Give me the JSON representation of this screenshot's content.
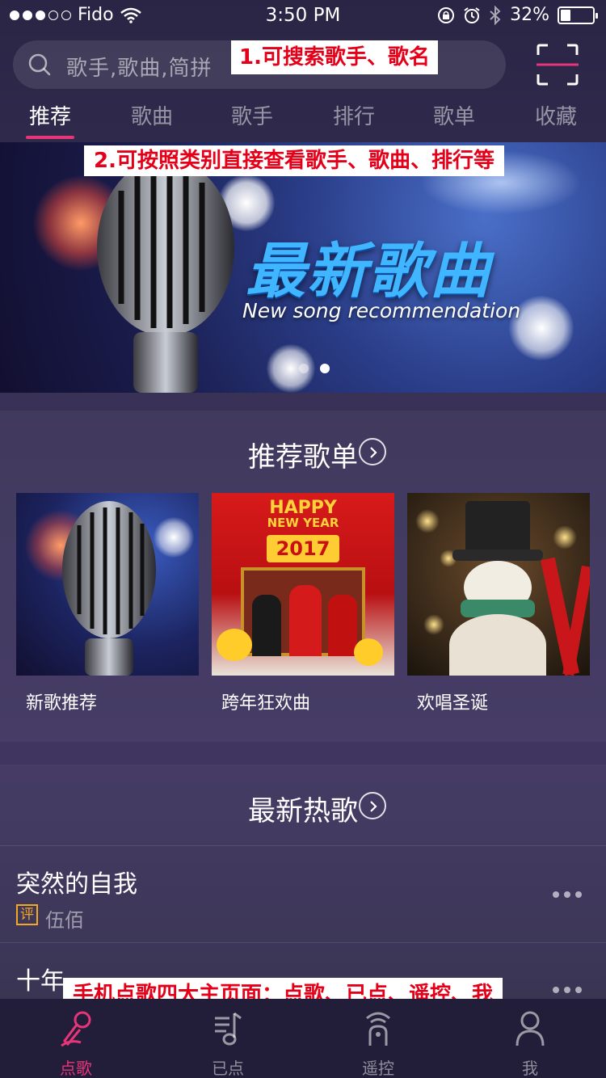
{
  "status_bar": {
    "carrier": "Fido",
    "time": "3:50 PM",
    "battery": "32%",
    "battery_level": 0.32
  },
  "search": {
    "placeholder": "歌手,歌曲,简拼"
  },
  "annotations": {
    "search_note": "1.可搜索歌手、歌名",
    "category_note": "2.可按照类别直接查看歌手、歌曲、排行等",
    "pages_note": "手机点歌四大主页面：点歌、已点、遥控、我"
  },
  "tabs": [
    {
      "label": "推荐",
      "active": true
    },
    {
      "label": "歌曲",
      "active": false
    },
    {
      "label": "歌手",
      "active": false
    },
    {
      "label": "排行",
      "active": false
    },
    {
      "label": "歌单",
      "active": false
    },
    {
      "label": "收藏",
      "active": false
    }
  ],
  "banner": {
    "title": "最新歌曲",
    "subtitle": "New song recommendation",
    "slide_count": 2,
    "active_slide": 2
  },
  "recommended_playlists": {
    "title": "推荐歌单",
    "items": [
      {
        "name": "新歌推荐"
      },
      {
        "name": "跨年狂欢曲",
        "cover_text": [
          "HAPPY",
          "NEW YEAR",
          "2017"
        ]
      },
      {
        "name": "欢唱圣诞"
      }
    ]
  },
  "hot_songs": {
    "title": "最新热歌",
    "items": [
      {
        "title": "突然的自我",
        "artist": "伍佰",
        "badge": "评"
      },
      {
        "title": "十年"
      }
    ]
  },
  "bottom_nav": [
    {
      "label": "点歌",
      "icon": "microphone-icon",
      "active": true
    },
    {
      "label": "已点",
      "icon": "playlist-music-icon",
      "active": false
    },
    {
      "label": "遥控",
      "icon": "remote-control-icon",
      "active": false
    },
    {
      "label": "我",
      "icon": "user-icon",
      "active": false
    }
  ],
  "colors": {
    "accent": "#e8357a",
    "annotation_text": "#e50019",
    "badge": "#f5a623"
  }
}
